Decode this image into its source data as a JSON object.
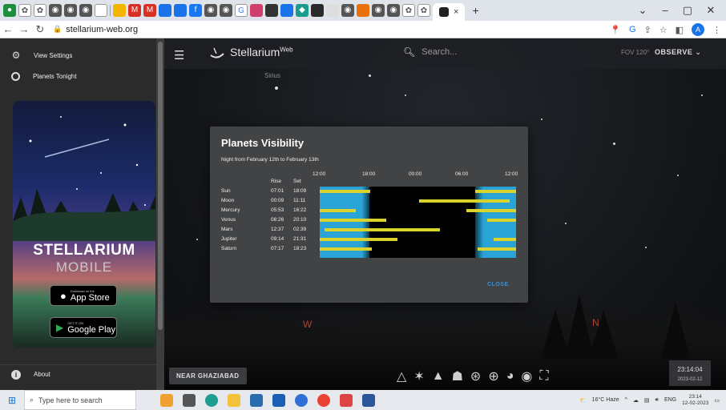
{
  "browser": {
    "active_tab_close": "×",
    "new_tab": "+",
    "url": "stellarium-web.org",
    "window_controls": [
      "⌄",
      "–",
      "▢",
      "✕"
    ]
  },
  "sidebar": {
    "items": [
      {
        "label": "View Settings",
        "icon": "gear-icon"
      },
      {
        "label": "Planets Tonight",
        "icon": "circle-icon"
      }
    ],
    "about": "About",
    "ad": {
      "title": "STELLARIUM",
      "subtitle": "MOBILE",
      "appstore_small": "Download on the",
      "appstore_big": "App Store",
      "googleplay_small": "GET IT ON",
      "googleplay_big": "Google Play"
    }
  },
  "app": {
    "name": "Stellarium",
    "name_sup": "Web",
    "search_placeholder": "Search...",
    "fov": "FOV 120°",
    "observe": "OBSERVE",
    "sky_labels": {
      "sirius": "Sirius"
    },
    "cardinals": {
      "west": "W",
      "north": "N"
    },
    "location": "NEAR GHAZIABAD",
    "clock_time": "23:14:04",
    "clock_date": "2023-02-12"
  },
  "dialog": {
    "title": "Planets Visibility",
    "subtitle": "Night from February 12th to February 13th",
    "time_labels": [
      "12:00",
      "18:00",
      "00:00",
      "06:00",
      "12:00"
    ],
    "col_rise": "Rise",
    "col_set": "Set",
    "planets": [
      {
        "name": "Sun",
        "rise": "07:01",
        "set": "18:09"
      },
      {
        "name": "Moon",
        "rise": "00:09",
        "set": "11:11"
      },
      {
        "name": "Mercury",
        "rise": "05:53",
        "set": "16:22"
      },
      {
        "name": "Venus",
        "rise": "08:26",
        "set": "20:10"
      },
      {
        "name": "Mars",
        "rise": "12:37",
        "set": "02:39"
      },
      {
        "name": "Jupiter",
        "rise": "09:14",
        "set": "21:31"
      },
      {
        "name": "Saturn",
        "rise": "07:17",
        "set": "18:23"
      }
    ],
    "close_label": "CLOSE"
  },
  "taskbar": {
    "search_placeholder": "Type here to search",
    "weather": "16°C Haze",
    "lang": "ENG",
    "time": "23:14",
    "date": "12-02-2023"
  },
  "colors": {
    "bar_yellow": "#d9d42c",
    "daylight_blue": "#2aa3d6",
    "close_blue": "#3a8fd8"
  }
}
